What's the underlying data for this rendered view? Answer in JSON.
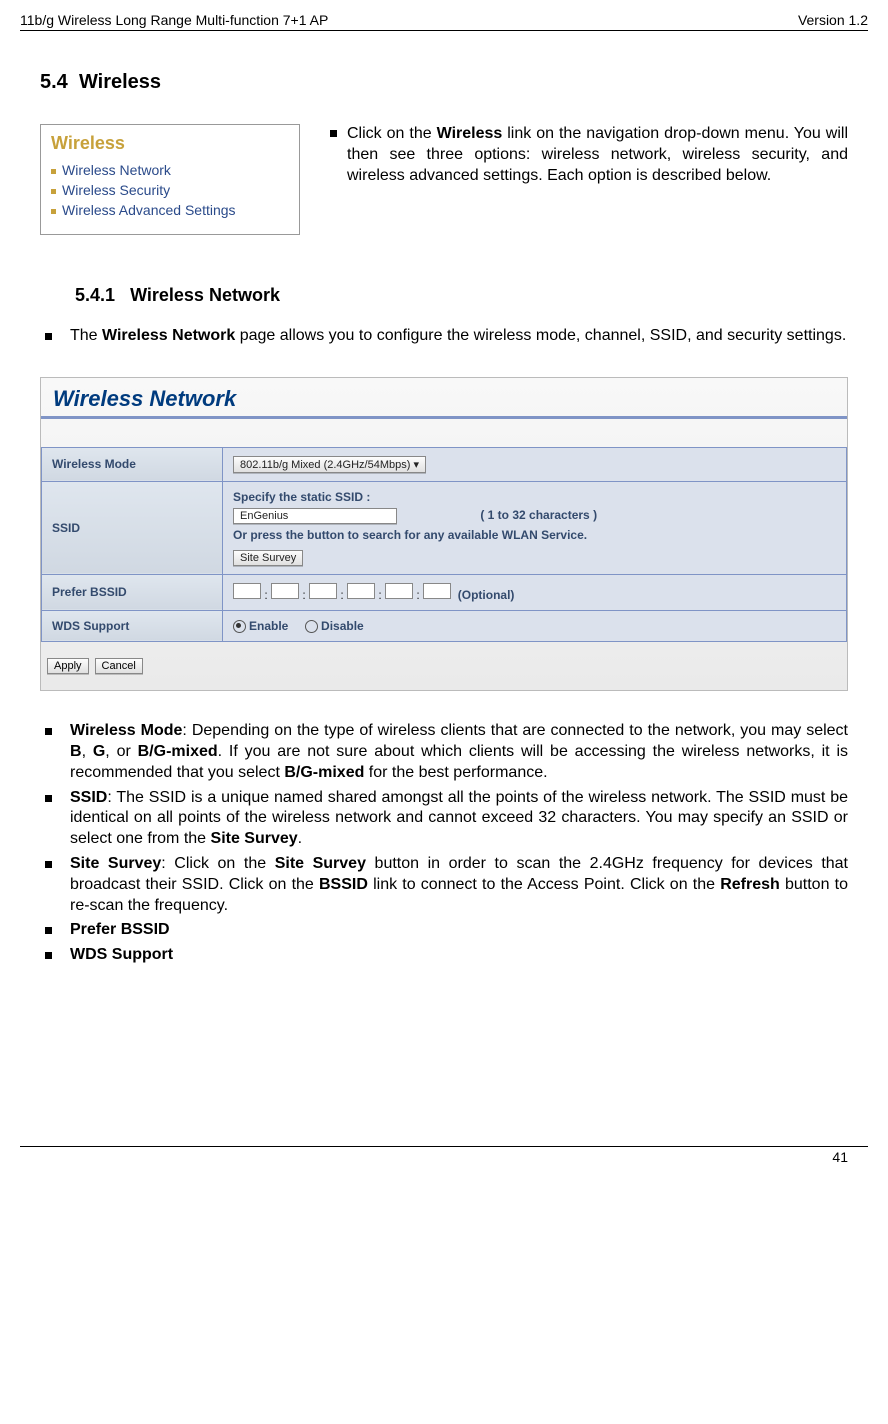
{
  "header": {
    "left": "11b/g Wireless Long Range Multi-function 7+1 AP",
    "right": "Version 1.2"
  },
  "sec": {
    "num": "5.4",
    "title": "Wireless"
  },
  "menu": {
    "title": "Wireless",
    "items": [
      "Wireless Network",
      "Wireless Security",
      "Wireless Advanced Settings"
    ]
  },
  "intro": {
    "pre": "Click on the ",
    "b1": "Wireless",
    "post": " link on the navigation drop-down menu. You will then see three options: wireless network, wireless security, and wireless advanced settings. Each option is described below."
  },
  "sub": {
    "num": "5.4.1",
    "title": "Wireless Network"
  },
  "p1": {
    "pre": "The ",
    "b1": "Wireless Network",
    "post": " page allows you to configure the wireless mode, channel, SSID, and security settings."
  },
  "cfg": {
    "title": "Wireless Network",
    "rows": {
      "mode": {
        "label": "Wireless Mode",
        "value": "802.11b/g Mixed (2.4GHz/54Mbps)"
      },
      "ssid": {
        "label": "SSID",
        "spec": "Specify the static SSID ",
        "colon": ":",
        "value": "EnGenius",
        "hint": "( 1 to 32 characters )",
        "or": "Or press the button to search for any available WLAN Service.",
        "btn": "Site Survey"
      },
      "bssid": {
        "label": "Prefer BSSID",
        "opt": "(Optional)"
      },
      "wds": {
        "label": "WDS Support",
        "enable": "Enable",
        "disable": "Disable"
      }
    },
    "apply": "Apply",
    "cancel": "Cancel"
  },
  "bullets": {
    "b1": {
      "t1": "Wireless Mode",
      "t2": ": Depending on the type of wireless clients that are connected to the network, you may select ",
      "t3": "B",
      "t4": ", ",
      "t5": "G",
      "t6": ", or ",
      "t7": "B/G-mixed",
      "t8": ". If you are not sure about which clients will be accessing the wireless networks, it is recommended that you select ",
      "t9": "B/G-mixed",
      "t10": " for the best performance."
    },
    "b2": {
      "t1": "SSID",
      "t2": ": The SSID is a unique named shared amongst all the points of the wireless network. The SSID must be identical on all points of the wireless network and cannot exceed 32 characters. You may specify an SSID or select one from the ",
      "t3": "Site Survey",
      "t4": "."
    },
    "b3": {
      "t1": "Site Survey",
      "t2": ": Click on the ",
      "t3": "Site Survey",
      "t4": " button in order to scan the 2.4GHz frequency for devices that broadcast their SSID. Click on the ",
      "t5": "BSSID",
      "t6": " link to connect to the Access Point. Click on the ",
      "t7": "Refresh",
      "t8": " button to re-scan the frequency."
    },
    "b4": {
      "t1": "Prefer BSSID"
    },
    "b5": {
      "t1": "WDS Support"
    }
  },
  "footer": {
    "page": "41"
  }
}
